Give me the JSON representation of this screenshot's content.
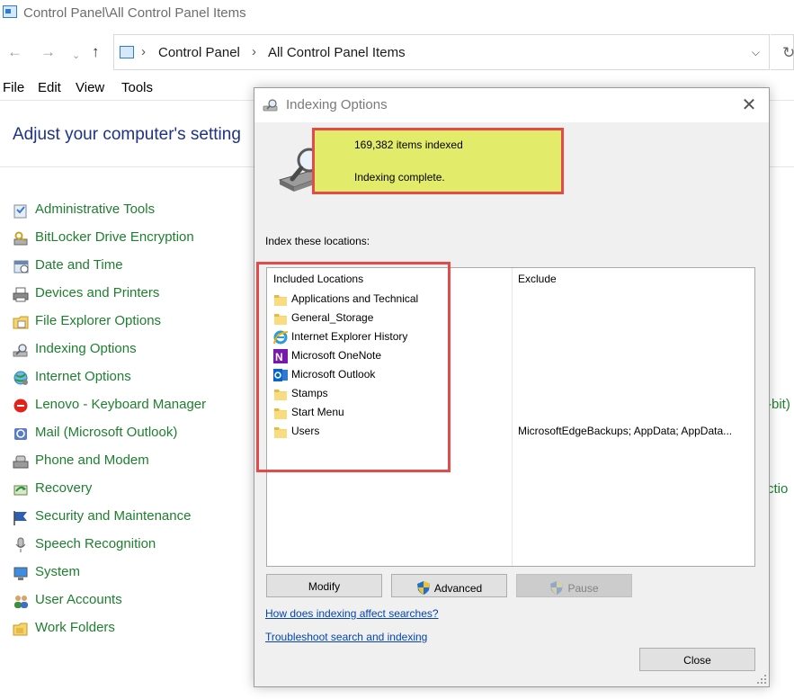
{
  "window": {
    "title": "Control Panel\\All Control Panel Items",
    "address": {
      "crumbs": [
        "Control Panel",
        "All Control Panel Items"
      ]
    },
    "menu": [
      "File",
      "Edit",
      "View",
      "Tools"
    ],
    "heading": "Adjust your computer's setting"
  },
  "control_panel_items": [
    {
      "label": "Administrative Tools",
      "icon": "admin-tools-icon"
    },
    {
      "label": "BitLocker Drive Encryption",
      "icon": "bitlocker-icon"
    },
    {
      "label": "Date and Time",
      "icon": "date-time-icon"
    },
    {
      "label": "Devices and Printers",
      "icon": "printer-icon"
    },
    {
      "label": "File Explorer Options",
      "icon": "folder-options-icon"
    },
    {
      "label": "Indexing Options",
      "icon": "indexing-icon"
    },
    {
      "label": "Internet Options",
      "icon": "internet-options-icon"
    },
    {
      "label": "Lenovo - Keyboard Manager",
      "icon": "lenovo-icon"
    },
    {
      "label": "Mail (Microsoft Outlook)",
      "icon": "mail-icon"
    },
    {
      "label": "Phone and Modem",
      "icon": "phone-modem-icon"
    },
    {
      "label": "Recovery",
      "icon": "recovery-icon"
    },
    {
      "label": "Security and Maintenance",
      "icon": "flag-icon"
    },
    {
      "label": "Speech Recognition",
      "icon": "microphone-icon"
    },
    {
      "label": "System",
      "icon": "system-icon"
    },
    {
      "label": "User Accounts",
      "icon": "users-icon"
    },
    {
      "label": "Work Folders",
      "icon": "work-folders-icon"
    }
  ],
  "right_column_fragments": [
    "-bit)",
    "ctio"
  ],
  "dialog": {
    "title": "Indexing Options",
    "status": {
      "count": "169,382 items indexed",
      "message": "Indexing complete."
    },
    "locations_label": "Index these locations:",
    "columns": {
      "included": "Included Locations",
      "exclude": "Exclude"
    },
    "locations": [
      {
        "name": "Applications and Technical",
        "exclude": "",
        "icon": "folder-icon"
      },
      {
        "name": "General_Storage",
        "exclude": "",
        "icon": "folder-icon"
      },
      {
        "name": "Internet Explorer History",
        "exclude": "",
        "icon": "internet-explorer-icon"
      },
      {
        "name": "Microsoft OneNote",
        "exclude": "",
        "icon": "onenote-icon"
      },
      {
        "name": "Microsoft Outlook",
        "exclude": "",
        "icon": "outlook-icon"
      },
      {
        "name": "Stamps",
        "exclude": "",
        "icon": "folder-icon"
      },
      {
        "name": "Start Menu",
        "exclude": "",
        "icon": "folder-icon"
      },
      {
        "name": "Users",
        "exclude": "MicrosoftEdgeBackups; AppData; AppData...",
        "icon": "folder-icon"
      }
    ],
    "buttons": {
      "modify": "Modify",
      "advanced": "Advanced",
      "pause": "Pause",
      "close": "Close"
    },
    "links": {
      "how": "How does indexing affect searches?",
      "troubleshoot": "Troubleshoot search and indexing"
    }
  },
  "colors": {
    "highlight_fill": "#e2eb6a",
    "highlight_border": "#e34a4a",
    "item_text": "#1e7f2e",
    "heading_text": "#1e3287",
    "link_text": "#0645ad"
  }
}
